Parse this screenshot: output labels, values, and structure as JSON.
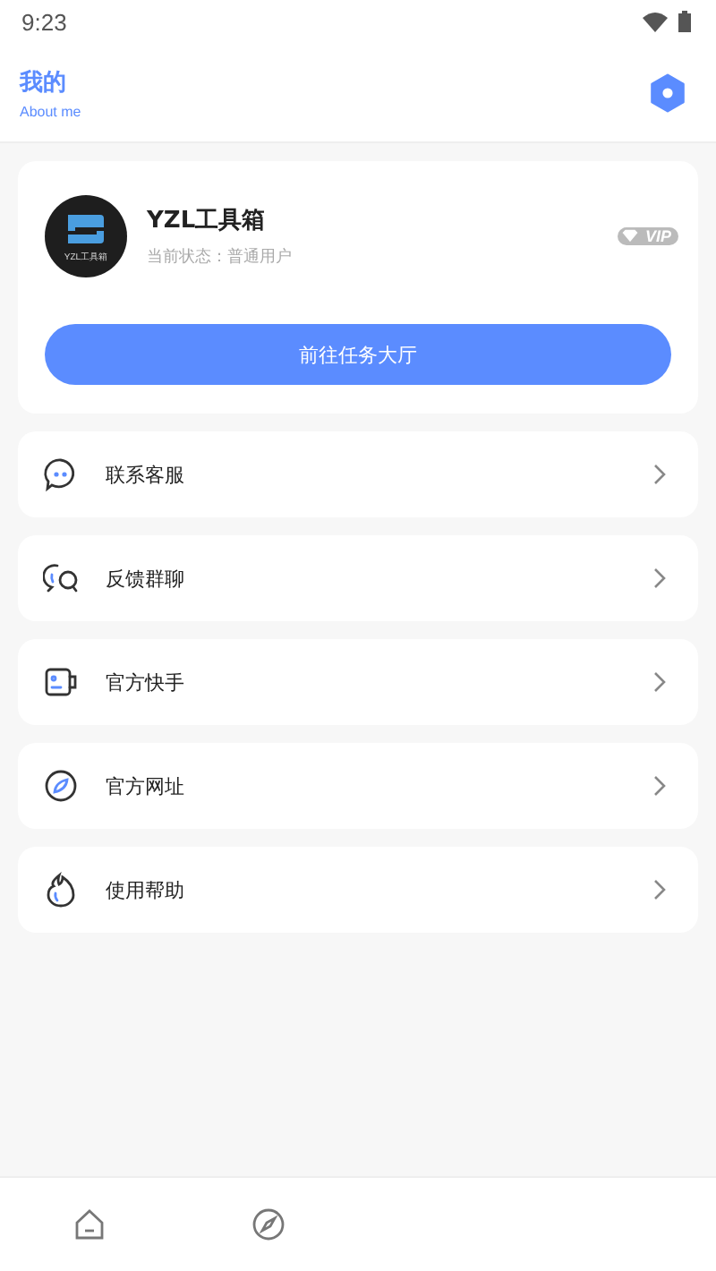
{
  "status_bar": {
    "time": "9:23"
  },
  "header": {
    "title": "我的",
    "subtitle": "About me"
  },
  "profile": {
    "avatar_caption": "YZL工具箱",
    "name": "YZL工具箱",
    "status": "当前状态：普通用户",
    "badge": "VIP",
    "button": "前往任务大厅"
  },
  "menu": [
    {
      "kind": "chat",
      "label": "联系客服"
    },
    {
      "kind": "group",
      "label": "反馈群聊"
    },
    {
      "kind": "video",
      "label": "官方快手"
    },
    {
      "kind": "compass",
      "label": "官方网址"
    },
    {
      "kind": "flame",
      "label": "使用帮助"
    }
  ],
  "bottom_nav": [
    {
      "kind": "home"
    },
    {
      "kind": "compass"
    }
  ]
}
